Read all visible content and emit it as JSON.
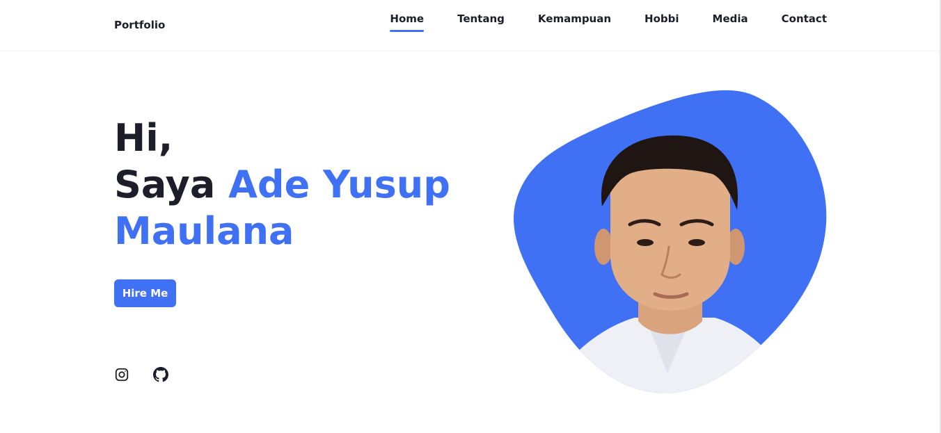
{
  "header": {
    "logo": "Portfolio",
    "nav": [
      {
        "label": "Home",
        "active": true
      },
      {
        "label": "Tentang",
        "active": false
      },
      {
        "label": "Kemampuan",
        "active": false
      },
      {
        "label": "Hobbi",
        "active": false
      },
      {
        "label": "Media",
        "active": false
      },
      {
        "label": "Contact",
        "active": false
      }
    ]
  },
  "hero": {
    "greeting": "Hi,",
    "intro": "Saya",
    "name_line1": "Ade Yusup",
    "name_line2": "Maulana",
    "cta_label": "Hire Me"
  },
  "social": [
    {
      "icon": "instagram-icon"
    },
    {
      "icon": "github-icon"
    }
  ],
  "colors": {
    "accent": "#4070f4",
    "text": "#1e1e2a",
    "background": "#ffffff"
  }
}
